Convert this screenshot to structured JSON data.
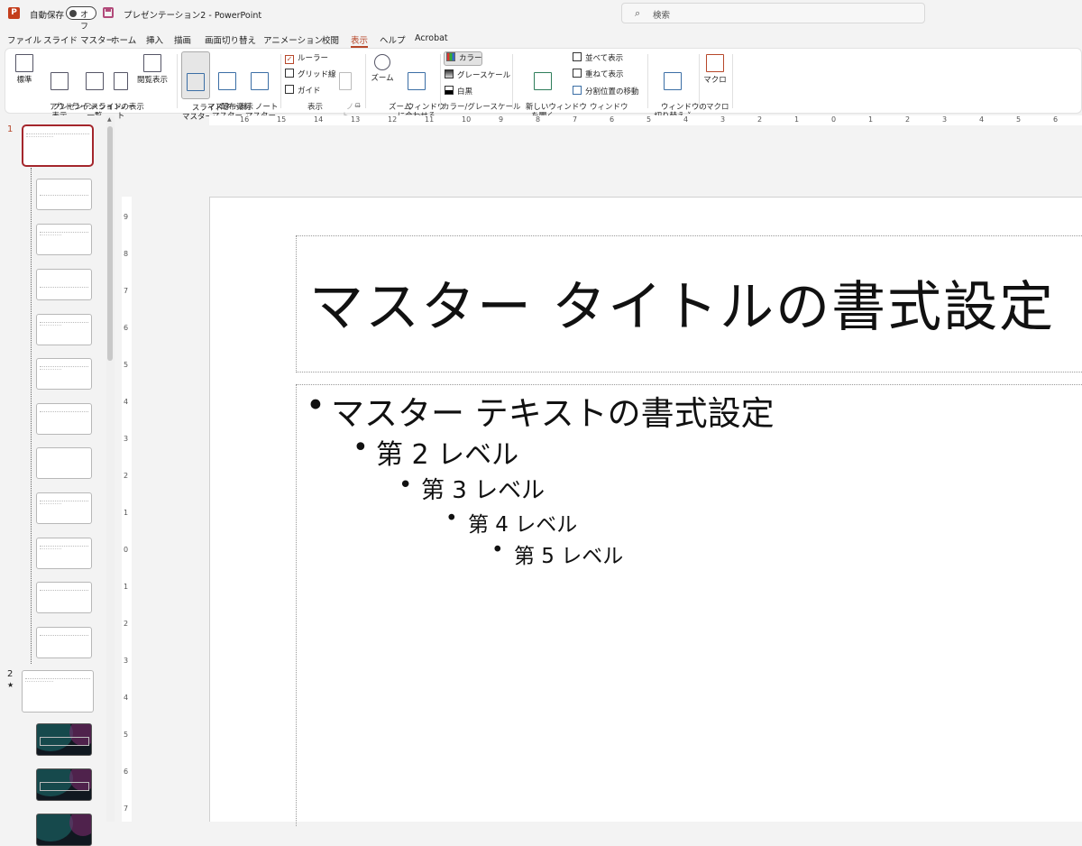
{
  "titlebar": {
    "app_icon": "P",
    "autosave_label": "自動保存",
    "autosave_state": "オフ",
    "doc_title": "プレゼンテーション2  -  PowerPoint",
    "search_placeholder": "検索"
  },
  "menu_tabs": [
    "ファイル",
    "スライド マスター",
    "ホーム",
    "挿入",
    "描画",
    "画面切り替え",
    "アニメーション",
    "校閲",
    "表示",
    "ヘルプ",
    "Acrobat"
  ],
  "active_tab": "表示",
  "ribbon": {
    "presentation_views": {
      "label": "プレゼンテーションの表示",
      "buttons": [
        "標準",
        "アウトライン\n表示",
        "スライド\n一覧",
        "ノー\nト",
        "閲覧表示"
      ]
    },
    "master_views": {
      "label": "マスター表示",
      "buttons": [
        "スライド\nマスター",
        "配布資料\nマスター",
        "ノート\nマスター"
      ]
    },
    "show": {
      "label": "表示",
      "ruler": "ルーラー",
      "gridlines": "グリッド線",
      "guides": "ガイド",
      "notes": "ノー\nト"
    },
    "zoom": {
      "label": "ズーム",
      "buttons": [
        "ズーム",
        "ウィンドウ\nに合わせる"
      ]
    },
    "color": {
      "label": "カラー/グレースケール",
      "items": [
        "カラー",
        "グレースケール",
        "白黒"
      ]
    },
    "window": {
      "label": "ウィンドウ",
      "new_window": "新しいウィンドウ\nを開く",
      "items": [
        "並べて表示",
        "重ねて表示",
        "分割位置の移動"
      ],
      "switch": "ウィンドウの\n切り替え ˅"
    },
    "macro": {
      "label": "マクロ",
      "button": "マクロ"
    }
  },
  "ruler_h_ticks": [
    "16",
    "15",
    "14",
    "13",
    "12",
    "11",
    "10",
    "9",
    "8",
    "7",
    "6",
    "5",
    "4",
    "3",
    "2",
    "1",
    "0",
    "1",
    "2",
    "3",
    "4",
    "5",
    "6"
  ],
  "ruler_v_ticks": [
    "9",
    "8",
    "7",
    "6",
    "5",
    "4",
    "3",
    "2",
    "1",
    "0",
    "1",
    "2",
    "3",
    "4",
    "5",
    "6",
    "7"
  ],
  "thumbnails": {
    "master_number": "1",
    "layout2_number": "2",
    "layout2_mark": "★"
  },
  "slide": {
    "title": "マスター タイトルの書式設定",
    "levels": [
      "マスター テキストの書式設定",
      "第 2 レベル",
      "第 3 レベル",
      "第 4 レベル",
      "第 5 レベル"
    ]
  }
}
